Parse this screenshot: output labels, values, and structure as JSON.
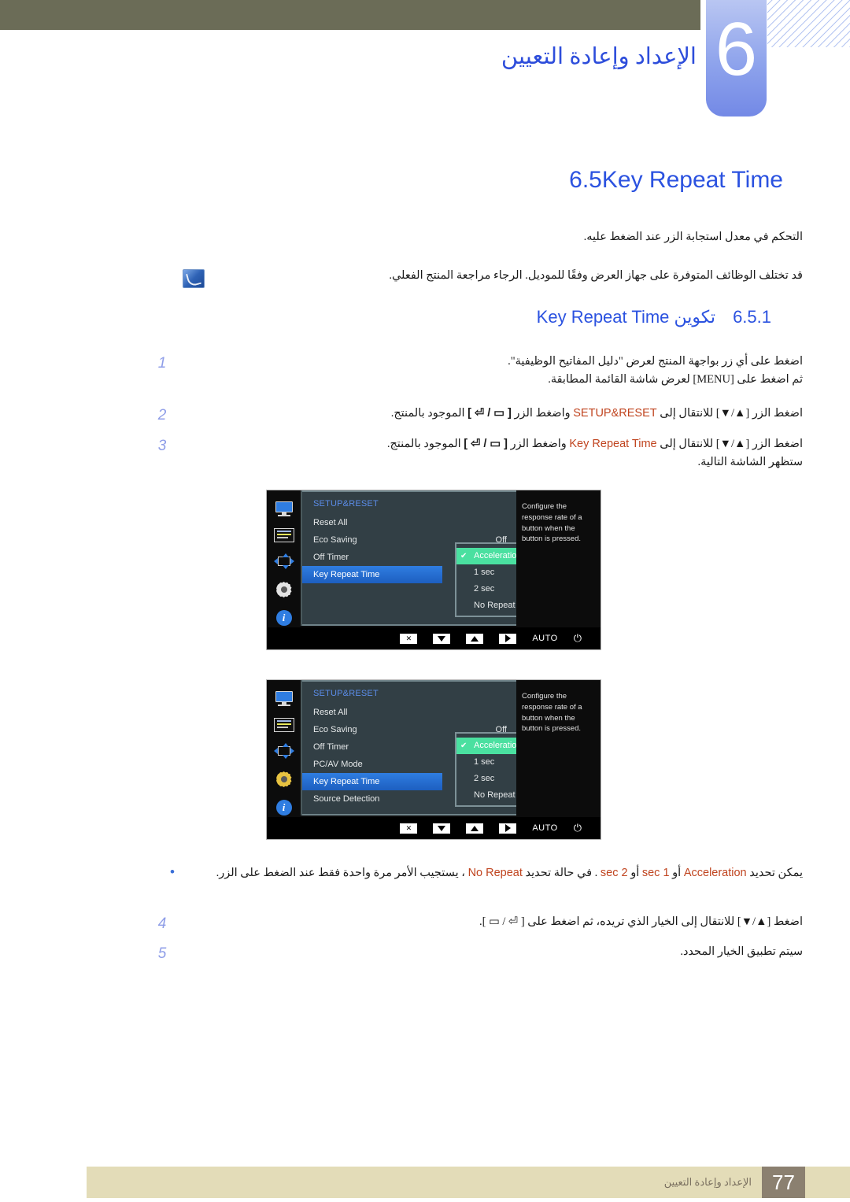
{
  "header": {
    "chapter_number": "6",
    "chapter_title": "الإعداد وإعادة التعيين"
  },
  "section": {
    "number": "6.5",
    "title": "Key Repeat Time",
    "intro": "التحكم في معدل استجابة الزر عند الضغط عليه.",
    "note": "قد تختلف الوظائف المتوفرة على جهاز العرض وفقًا للموديل. الرجاء مراجعة المنتج الفعلي."
  },
  "subsection": {
    "number": "6.5.1",
    "title_en": "Key Repeat Time",
    "title_ar": "تكوين"
  },
  "steps": [
    {
      "num": "1",
      "line1_a": "اضغط على أي زر بواجهة المنتج لعرض \"دليل المفاتيح الوظيفية\".",
      "line2_a": "ثم اضغط على [MENU] لعرض شاشة القائمة المطابقة."
    },
    {
      "num": "2",
      "pre": "اضغط الزر [▲/▼] للانتقال إلى",
      "kw": "SETUP&RESET",
      "mid": "واضغط الزر",
      "key": "[ ⏎ / ▭ ]",
      "post": "الموجود بالمنتج."
    },
    {
      "num": "3",
      "pre": "اضغط الزر [▲/▼] للانتقال إلى",
      "kw": "Key Repeat Time",
      "mid": "واضغط الزر",
      "key": "[ ⏎ / ▭ ]",
      "post": "الموجود بالمنتج.",
      "extra": "ستظهر الشاشة التالية."
    },
    {
      "num": "4",
      "text": "اضغط [▲/▼] للانتقال إلى الخيار الذي تريده، ثم اضغط على [ ⏎ / ▭ ]."
    },
    {
      "num": "5",
      "text": "سيتم تطبيق الخيار المحدد."
    }
  ],
  "bullet_note": {
    "dot": "•",
    "text_parts": {
      "a": "يمكن تحديد",
      "kw1": "Acceleration",
      "b": "أو",
      "kw2": "1 sec",
      "c": "أو",
      "kw3": "2 sec",
      "d": ". في حالة تحديد",
      "kw4": "No Repeat",
      "e": "، يستجيب الأمر مرة واحدة فقط عند الضغط على الزر."
    }
  },
  "osd": {
    "title": "SETUP&RESET",
    "description": "Configure the response rate of a button when the button is pressed.",
    "bottom_keys": {
      "close": "✕",
      "down": "▼",
      "up": "▲",
      "enter": "▶",
      "auto": "AUTO",
      "power": "⏻"
    },
    "submenu": {
      "options": [
        {
          "label": "Acceleration",
          "checked": true
        },
        {
          "label": "1 sec",
          "checked": false
        },
        {
          "label": "2 sec",
          "checked": false
        },
        {
          "label": "No Repeat",
          "checked": false
        }
      ]
    },
    "screen_a": {
      "items": [
        {
          "label": "Reset All",
          "value": "",
          "selected": false
        },
        {
          "label": "Eco Saving",
          "value": "Off",
          "selected": false
        },
        {
          "label": "Off Timer",
          "value": "",
          "selected": false
        },
        {
          "label": "Key Repeat Time",
          "value": "",
          "selected": true
        }
      ]
    },
    "screen_b": {
      "items": [
        {
          "label": "Reset All",
          "value": "",
          "selected": false
        },
        {
          "label": "Eco Saving",
          "value": "Off",
          "selected": false
        },
        {
          "label": "Off Timer",
          "value": "",
          "selected": false
        },
        {
          "label": "PC/AV Mode",
          "value": "",
          "selected": false
        },
        {
          "label": "Key Repeat Time",
          "value": "",
          "selected": true
        },
        {
          "label": "Source Detection",
          "value": "",
          "selected": false
        }
      ]
    }
  },
  "footer": {
    "page_number": "77",
    "text": "الإعداد وإعادة التعيين"
  },
  "colors": {
    "header_bar": "#6b6c57",
    "heading_blue": "#2b52e0",
    "keyword_orange": "#c0441f",
    "step_number": "#8f9ee8",
    "footer_bar": "#e3dcb8",
    "page_badge": "#8b8070",
    "osd_highlight": "#2f7de1",
    "osd_check": "#4ae0a0"
  }
}
